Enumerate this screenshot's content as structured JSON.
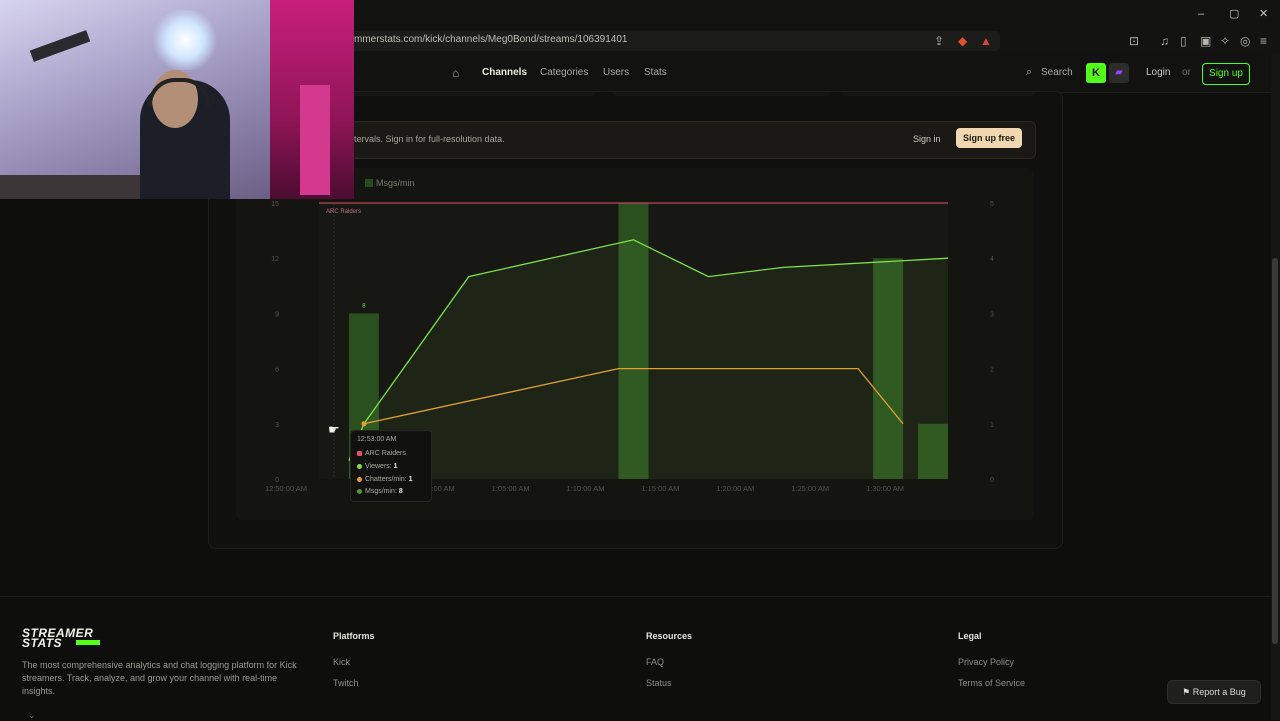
{
  "browser": {
    "url": "mmerstats.com/kick/channels/Meg0Bond/streams/106391401",
    "window_controls": {
      "minimize": "–",
      "maximize": "▢",
      "close": "✕"
    }
  },
  "nav": {
    "home_icon": "home-icon",
    "links": [
      "Channels",
      "Categories",
      "Users",
      "Stats"
    ],
    "search": "Search",
    "login": "Login",
    "or": "or",
    "signup": "Sign up"
  },
  "banner": {
    "text": "tervals. Sign in for full-resolution data.",
    "signin": "Sign in",
    "signup": "Sign up free"
  },
  "legend": {
    "msgs": "Msgs/min"
  },
  "tooltip": {
    "time": "12:53:00 AM",
    "category": "ARC Raiders",
    "viewers_label": "Viewers:",
    "viewers_value": "1",
    "chatters_label": "Chatters/min:",
    "chatters_value": "1",
    "msgs_label": "Msgs/min:",
    "msgs_value": "8"
  },
  "chart_data": {
    "type": "line",
    "category_label": "ARC Raiders",
    "x_ticks": [
      "12:50:00 AM",
      "1",
      "1:00:00 AM",
      "1:05:00 AM",
      "1:10:00 AM",
      "1:15:00 AM",
      "1:20:00 AM",
      "1:25:00 AM",
      "1:30:00 AM"
    ],
    "y_left_ticks": [
      "0",
      "3",
      "6",
      "9",
      "12",
      "15"
    ],
    "y_right_ticks": [
      "0",
      "1",
      "2",
      "3",
      "4",
      "5"
    ],
    "y_left_range": [
      0,
      15
    ],
    "y_right_range": [
      0,
      5
    ],
    "x_range_minutes": [
      0,
      42
    ],
    "series": [
      {
        "name": "Viewers",
        "color": "#7ee04a",
        "axis": "left",
        "x_minutes": [
          2,
          3,
          10,
          21,
          26,
          31,
          42
        ],
        "values": [
          1,
          3,
          11,
          13,
          11,
          11.5,
          12
        ]
      },
      {
        "name": "Chatters/min",
        "color": "#e0a030",
        "axis": "right",
        "x_minutes": [
          3,
          20,
          36,
          39
        ],
        "values": [
          1,
          2,
          2,
          1
        ]
      },
      {
        "name": "Msgs/min",
        "color": "#2f5a22",
        "axis": "left",
        "bars": [
          {
            "x_start": 2,
            "x_end": 4,
            "value": 9,
            "label": "8"
          },
          {
            "x_start": 20,
            "x_end": 22,
            "value": 15
          },
          {
            "x_start": 37,
            "x_end": 39,
            "value": 12
          },
          {
            "x_start": 40,
            "x_end": 42,
            "value": 3
          }
        ]
      }
    ],
    "category_band": {
      "name": "ARC Raiders",
      "color": "#e0506a",
      "value": 15
    },
    "grid": false
  },
  "footer": {
    "logo_line1": "STREAMER",
    "logo_line2": "STATS",
    "tagline": "The most comprehensive analytics and chat logging platform for Kick streamers. Track, analyze, and grow your channel with real-time insights.",
    "platforms": {
      "title": "Platforms",
      "links": [
        "Kick",
        "Twitch"
      ]
    },
    "resources": {
      "title": "Resources",
      "links": [
        "FAQ",
        "Status"
      ]
    },
    "legal": {
      "title": "Legal",
      "links": [
        "Privacy Policy",
        "Terms of Service"
      ]
    },
    "report_bug": "Report a Bug"
  },
  "colors": {
    "accent": "#53fc18",
    "signup_free_bg": "#f0d7b0"
  }
}
